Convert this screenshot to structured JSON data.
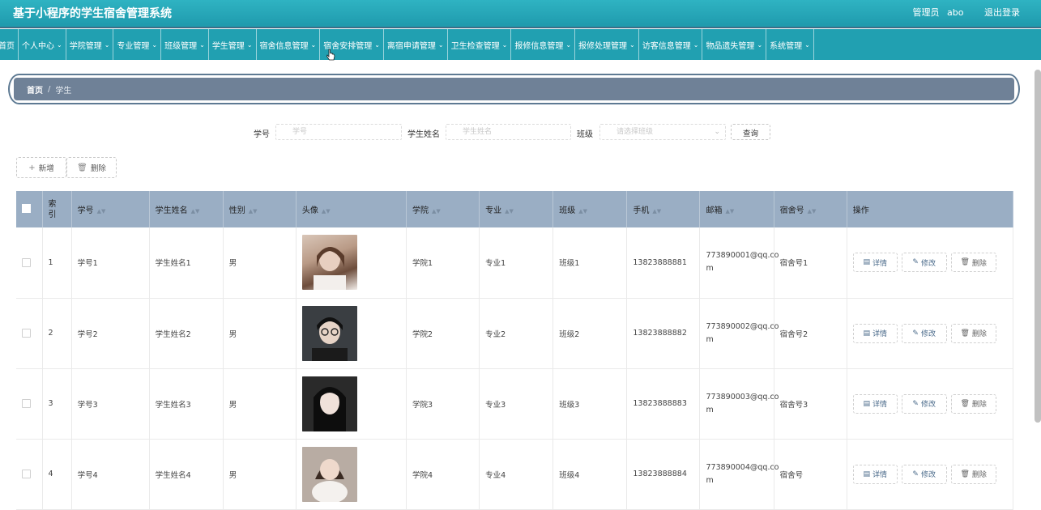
{
  "header": {
    "title": "基于小程序的学生宿舍管理系统",
    "role": "管理员",
    "user": "abo",
    "logout": "退出登录"
  },
  "nav": [
    {
      "label": "首页",
      "icon": ""
    },
    {
      "label": "个人中心",
      "icon": "chevron-down-icon"
    },
    {
      "label": "学院管理",
      "icon": "chevron-down-icon"
    },
    {
      "label": "专业管理",
      "icon": "chevron-down-icon"
    },
    {
      "label": "班级管理",
      "icon": "chevron-down-icon"
    },
    {
      "label": "学生管理",
      "icon": "chevron-down-icon"
    },
    {
      "label": "宿舍信息管理",
      "icon": "chevron-down-icon"
    },
    {
      "label": "宿舍安排管理",
      "icon": "chevron-down-icon"
    },
    {
      "label": "离宿申请管理",
      "icon": "chevron-down-icon"
    },
    {
      "label": "卫生检查管理",
      "icon": "chevron-down-icon"
    },
    {
      "label": "报修信息管理",
      "icon": "chevron-down-icon"
    },
    {
      "label": "报修处理管理",
      "icon": "chevron-down-icon"
    },
    {
      "label": "访客信息管理",
      "icon": "chevron-down-icon"
    },
    {
      "label": "物品遗失管理",
      "icon": "chevron-down-icon"
    },
    {
      "label": "系统管理",
      "icon": "chevron-down-icon"
    }
  ],
  "breadcrumb": {
    "home": "首页",
    "separator": "/",
    "current": "学生"
  },
  "search": {
    "student_id_label": "学号",
    "student_id_placeholder": "学号",
    "student_name_label": "学生姓名",
    "student_name_placeholder": "学生姓名",
    "class_label": "班级",
    "class_placeholder": "请选择班级",
    "query_button": "查询"
  },
  "actions": {
    "add": "新增",
    "delete": "删除"
  },
  "table": {
    "columns": [
      "索引",
      "学号",
      "学生姓名",
      "性别",
      "头像",
      "学院",
      "专业",
      "班级",
      "手机",
      "邮箱",
      "宿舍号",
      "操作"
    ],
    "rows": [
      {
        "index": "1",
        "student_id": "学号1",
        "name": "学生姓名1",
        "gender": "男",
        "college": "学院1",
        "major": "专业1",
        "class": "班级1",
        "phone": "13823888881",
        "email_line1": "773890001@qq.co",
        "email_line2": "m",
        "dorm": "宿舍号1"
      },
      {
        "index": "2",
        "student_id": "学号2",
        "name": "学生姓名2",
        "gender": "男",
        "college": "学院2",
        "major": "专业2",
        "class": "班级2",
        "phone": "13823888882",
        "email_line1": "773890002@qq.co",
        "email_line2": "m",
        "dorm": "宿舍号2"
      },
      {
        "index": "3",
        "student_id": "学号3",
        "name": "学生姓名3",
        "gender": "男",
        "college": "学院3",
        "major": "专业3",
        "class": "班级3",
        "phone": "13823888883",
        "email_line1": "773890003@qq.co",
        "email_line2": "m",
        "dorm": "宿舍号3"
      },
      {
        "index": "4",
        "student_id": "学号4",
        "name": "学生姓名4",
        "gender": "男",
        "college": "学院4",
        "major": "专业4",
        "class": "班级4",
        "phone": "13823888884",
        "email_line1": "773890004@qq.co",
        "email_line2": "m",
        "dorm": "宿舍号"
      }
    ],
    "row_actions": {
      "detail": "详情",
      "edit": "修改",
      "delete": "删除"
    }
  },
  "colors": {
    "header_bg": "#21a0b1",
    "breadcrumb_bg": "#6f8197",
    "table_header_bg": "#9aaec4"
  }
}
